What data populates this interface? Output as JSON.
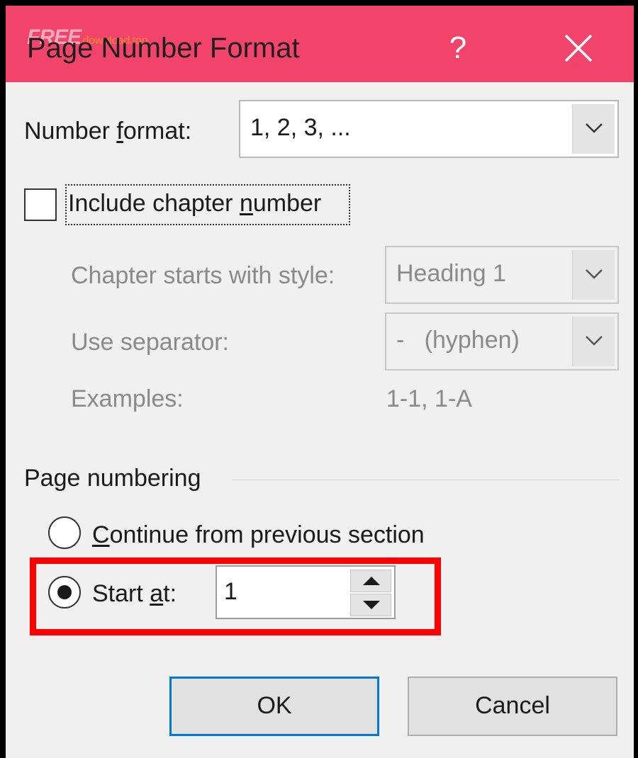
{
  "dialog": {
    "title": "Page Number Format",
    "help_label": "?",
    "watermark": "FREE",
    "watermark_sub": "download.top"
  },
  "number_format": {
    "label_before": "Number ",
    "label_accel": "f",
    "label_after": "ormat:",
    "value": "1, 2, 3, ..."
  },
  "include_chapter": {
    "label_before": "Include chapter ",
    "label_accel": "n",
    "label_after": "umber",
    "checked": false
  },
  "chapter_style": {
    "label": "Chapter starts with style:",
    "value": "Heading 1"
  },
  "separator": {
    "label": "Use separator:",
    "value": "-   (hyphen)"
  },
  "examples": {
    "label": "Examples:",
    "value": "1-1, 1-A"
  },
  "page_numbering": {
    "group_label": "Page numbering",
    "continue_accel": "C",
    "continue_label": "ontinue from previous section",
    "start_label_before": "Start ",
    "start_accel": "a",
    "start_label_after": "t:",
    "start_value": "1",
    "selected": "start_at"
  },
  "buttons": {
    "ok": "OK",
    "cancel": "Cancel"
  },
  "colors": {
    "titlebar": "#f2436b",
    "highlight": "#ff0000",
    "default_button_border": "#0078d7"
  }
}
